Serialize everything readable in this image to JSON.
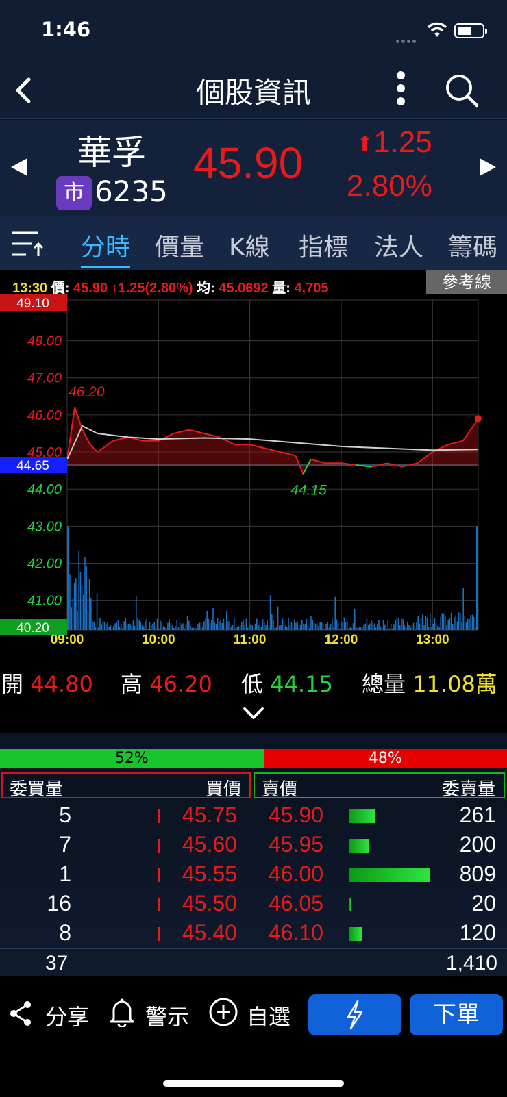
{
  "status_bar": {
    "time": "1:46"
  },
  "nav": {
    "title": "個股資訊"
  },
  "quote": {
    "name": "華孚",
    "market_badge": "市",
    "code": "6235",
    "price": "45.90",
    "change": "1.25",
    "change_pct": "2.80%"
  },
  "tabs": [
    "分時",
    "價量",
    "K線",
    "指標",
    "法人",
    "籌碼"
  ],
  "info": {
    "time": "13:30",
    "price_label": "價:",
    "price": "45.90",
    "change": "1.25(2.80%)",
    "avg_label": "均:",
    "avg": "45.0692",
    "vol_label": "量:",
    "vol": "4,705",
    "ref_button": "參考線"
  },
  "chart_data": {
    "type": "line",
    "title": "",
    "y_axis_labels": [
      "48.00",
      "47.00",
      "46.00",
      "45.00",
      "44.00",
      "43.00",
      "42.00",
      "41.00"
    ],
    "y_max_label": "49.10",
    "y_min_label": "40.20",
    "reference_label": "44.65",
    "reference_price": 44.65,
    "high_annotation": "46.20",
    "low_annotation": "44.15",
    "ylim": [
      40.2,
      49.1
    ],
    "x_tick_labels": [
      "09:00",
      "10:00",
      "11:00",
      "12:00",
      "13:00"
    ],
    "series": [
      {
        "name": "",
        "color": "#e81a1a",
        "x": [
          "09:00",
          "09:05",
          "09:10",
          "09:15",
          "09:20",
          "09:30",
          "09:40",
          "09:50",
          "10:00",
          "10:10",
          "10:20",
          "10:30",
          "10:40",
          "10:50",
          "11:00",
          "11:10",
          "11:20",
          "11:30",
          "11:35",
          "11:40",
          "11:50",
          "12:00",
          "12:10",
          "12:20",
          "12:30",
          "12:40",
          "12:50",
          "13:00",
          "13:10",
          "13:20",
          "13:30"
        ],
        "values": [
          44.8,
          46.2,
          45.6,
          45.2,
          45.0,
          45.3,
          45.4,
          45.3,
          45.3,
          45.5,
          45.6,
          45.5,
          45.4,
          45.2,
          45.2,
          45.1,
          45.0,
          44.9,
          44.4,
          44.8,
          44.7,
          44.7,
          44.65,
          44.6,
          44.7,
          44.6,
          44.7,
          45.0,
          45.2,
          45.3,
          45.9
        ]
      },
      {
        "name": "",
        "color": "#d0d0d0",
        "x": [
          "09:00",
          "09:10",
          "09:20",
          "09:40",
          "10:00",
          "10:30",
          "11:00",
          "11:30",
          "12:00",
          "12:30",
          "13:00",
          "13:30"
        ],
        "values": [
          44.8,
          45.7,
          45.5,
          45.4,
          45.35,
          45.38,
          45.35,
          45.25,
          45.15,
          45.1,
          45.05,
          45.07
        ]
      }
    ]
  },
  "stats": {
    "open_label": "開",
    "open": "44.80",
    "high_label": "高",
    "high": "46.20",
    "low_label": "低",
    "low": "44.15",
    "vol_label": "總量",
    "vol": "11.08萬"
  },
  "ratio": {
    "buy": "52%",
    "sell": "48%",
    "buy_fraction": 0.52
  },
  "order_book": {
    "headers": {
      "bid_vol": "委買量",
      "bid_price": "買價",
      "ask_price": "賣價",
      "ask_vol": "委賣量"
    },
    "rows": [
      {
        "bid_vol": "5",
        "bid_price": "45.75",
        "ask_price": "45.90",
        "ask_vol": "261"
      },
      {
        "bid_vol": "7",
        "bid_price": "45.60",
        "ask_price": "45.95",
        "ask_vol": "200"
      },
      {
        "bid_vol": "1",
        "bid_price": "45.55",
        "ask_price": "46.00",
        "ask_vol": "809"
      },
      {
        "bid_vol": "16",
        "bid_price": "45.50",
        "ask_price": "46.05",
        "ask_vol": "20"
      },
      {
        "bid_vol": "8",
        "bid_price": "45.40",
        "ask_price": "46.10",
        "ask_vol": "120"
      }
    ],
    "total_bid": "37",
    "total_ask": "1,410"
  },
  "footer": {
    "share": "分享",
    "alert": "警示",
    "watchlist": "自選",
    "order": "下單"
  }
}
